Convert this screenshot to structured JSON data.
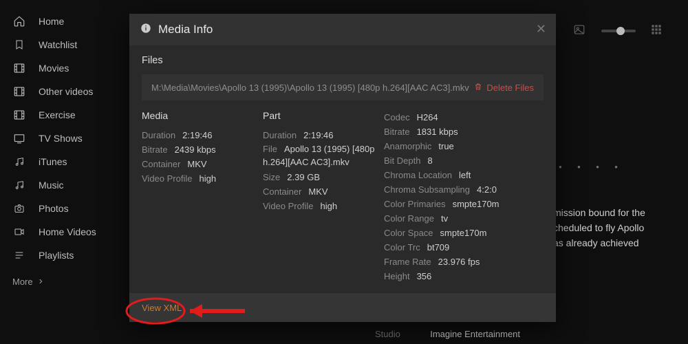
{
  "sidebar": {
    "items": [
      {
        "label": "Home"
      },
      {
        "label": "Watchlist"
      },
      {
        "label": "Movies"
      },
      {
        "label": "Other videos"
      },
      {
        "label": "Exercise"
      },
      {
        "label": "TV Shows"
      },
      {
        "label": "iTunes"
      },
      {
        "label": "Music"
      },
      {
        "label": "Photos"
      },
      {
        "label": "Home Videos"
      },
      {
        "label": "Playlists"
      }
    ],
    "more": "More"
  },
  "modal": {
    "title": "Media Info",
    "files_label": "Files",
    "file_path": "M:\\Media\\Movies\\Apollo 13 (1995)\\Apollo 13 (1995) [480p h.264][AAC AC3].mkv",
    "delete_label": "Delete Files",
    "media": {
      "heading": "Media",
      "duration_k": "Duration",
      "duration_v": "2:19:46",
      "bitrate_k": "Bitrate",
      "bitrate_v": "2439 kbps",
      "container_k": "Container",
      "container_v": "MKV",
      "vprofile_k": "Video Profile",
      "vprofile_v": "high"
    },
    "part": {
      "heading": "Part",
      "duration_k": "Duration",
      "duration_v": "2:19:46",
      "file_k": "File",
      "file_v": "Apollo 13 (1995) [480p h.264][AAC AC3].mkv",
      "size_k": "Size",
      "size_v": "2.39 GB",
      "container_k": "Container",
      "container_v": "MKV",
      "vprofile_k": "Video Profile",
      "vprofile_v": "high"
    },
    "stream": {
      "codec_k": "Codec",
      "codec_v": "H264",
      "bitrate_k": "Bitrate",
      "bitrate_v": "1831 kbps",
      "anam_k": "Anamorphic",
      "anam_v": "true",
      "bitd_k": "Bit Depth",
      "bitd_v": "8",
      "chloc_k": "Chroma Location",
      "chloc_v": "left",
      "chsub_k": "Chroma Subsampling",
      "chsub_v": "4:2:0",
      "cprim_k": "Color Primaries",
      "cprim_v": "smpte170m",
      "crange_k": "Color Range",
      "crange_v": "tv",
      "cspace_k": "Color Space",
      "cspace_v": "smpte170m",
      "ctrc_k": "Color Trc",
      "ctrc_v": "bt709",
      "frate_k": "Frame Rate",
      "frate_v": "23.976 fps",
      "height_k": "Height",
      "height_v": "356"
    },
    "view_xml": "View XML"
  },
  "background": {
    "desc_line1": "mission bound for the",
    "desc_line2": "cheduled to fly Apollo",
    "desc_line3": "as already achieved",
    "studio_k": "Studio",
    "studio_v": "Imagine Entertainment"
  }
}
